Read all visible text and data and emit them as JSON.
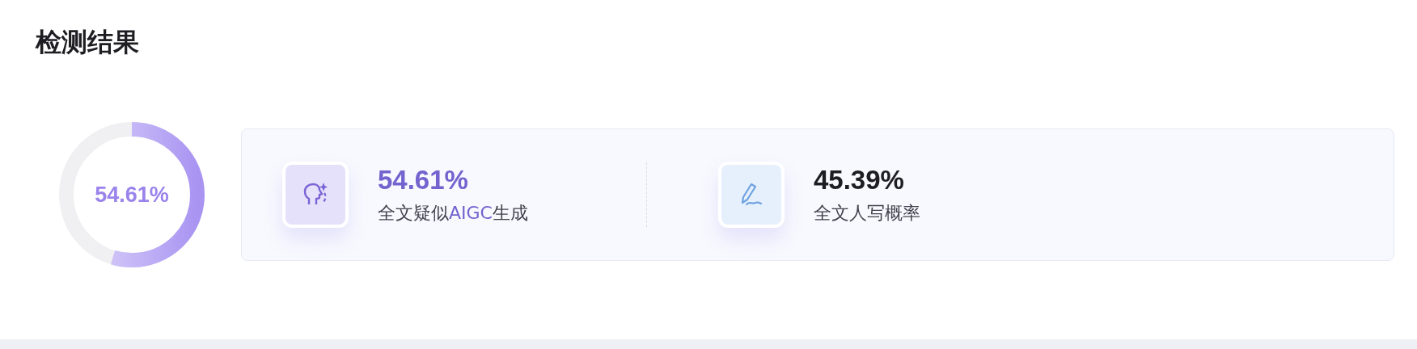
{
  "title": "检测结果",
  "donut": {
    "level": 0.5461,
    "label": "54.61%"
  },
  "results": [
    {
      "kind": "ai",
      "value": "54.61%",
      "label": [
        {
          "text": "全文疑似",
          "highlight": false
        },
        {
          "text": "AIGC",
          "highlight": true
        },
        {
          "text": "生成",
          "highlight": false
        }
      ]
    },
    {
      "kind": "human",
      "value": "45.39%",
      "label": [
        {
          "text": "全文人写概率",
          "highlight": false
        }
      ]
    }
  ]
}
